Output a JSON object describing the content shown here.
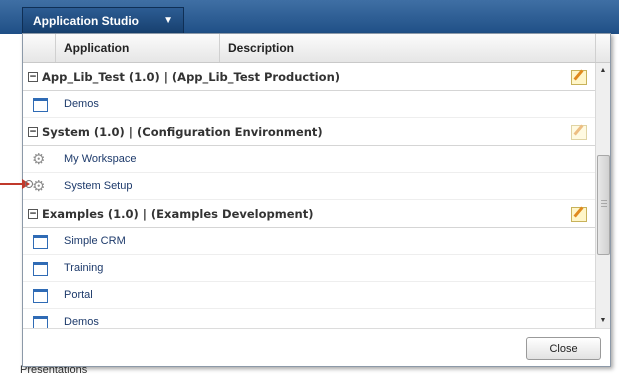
{
  "toolbar": {
    "app_studio_label": "Application Studio",
    "app_studio_chevron": "chevron-down-icon"
  },
  "background": {
    "bottom_text": "Presentations"
  },
  "grid": {
    "columns": [
      "Application",
      "Description"
    ],
    "groups": [
      {
        "title": "App_Lib_Test (1.0) | (App_Lib_Test Production)",
        "edit_icon_faded": false,
        "items": [
          {
            "label": "Demos",
            "icon": "window-icon"
          }
        ]
      },
      {
        "title": "System (1.0) | (Configuration Environment)",
        "edit_icon_faded": true,
        "items": [
          {
            "label": "My Workspace",
            "icon": "gear-icon"
          },
          {
            "label": "System Setup",
            "icon": "gear-icon"
          }
        ]
      },
      {
        "title": "Examples (1.0) | (Examples Development)",
        "edit_icon_faded": false,
        "items": [
          {
            "label": "Simple CRM",
            "icon": "window-icon"
          },
          {
            "label": "Training",
            "icon": "window-icon"
          },
          {
            "label": "Portal",
            "icon": "window-icon"
          },
          {
            "label": "Demos",
            "icon": "window-icon"
          }
        ]
      }
    ]
  },
  "dialog": {
    "close_label": "Close"
  },
  "colors": {
    "accent": "#1f4f86",
    "link_text": "#1d3a6b",
    "pointer": "#c0392b"
  }
}
